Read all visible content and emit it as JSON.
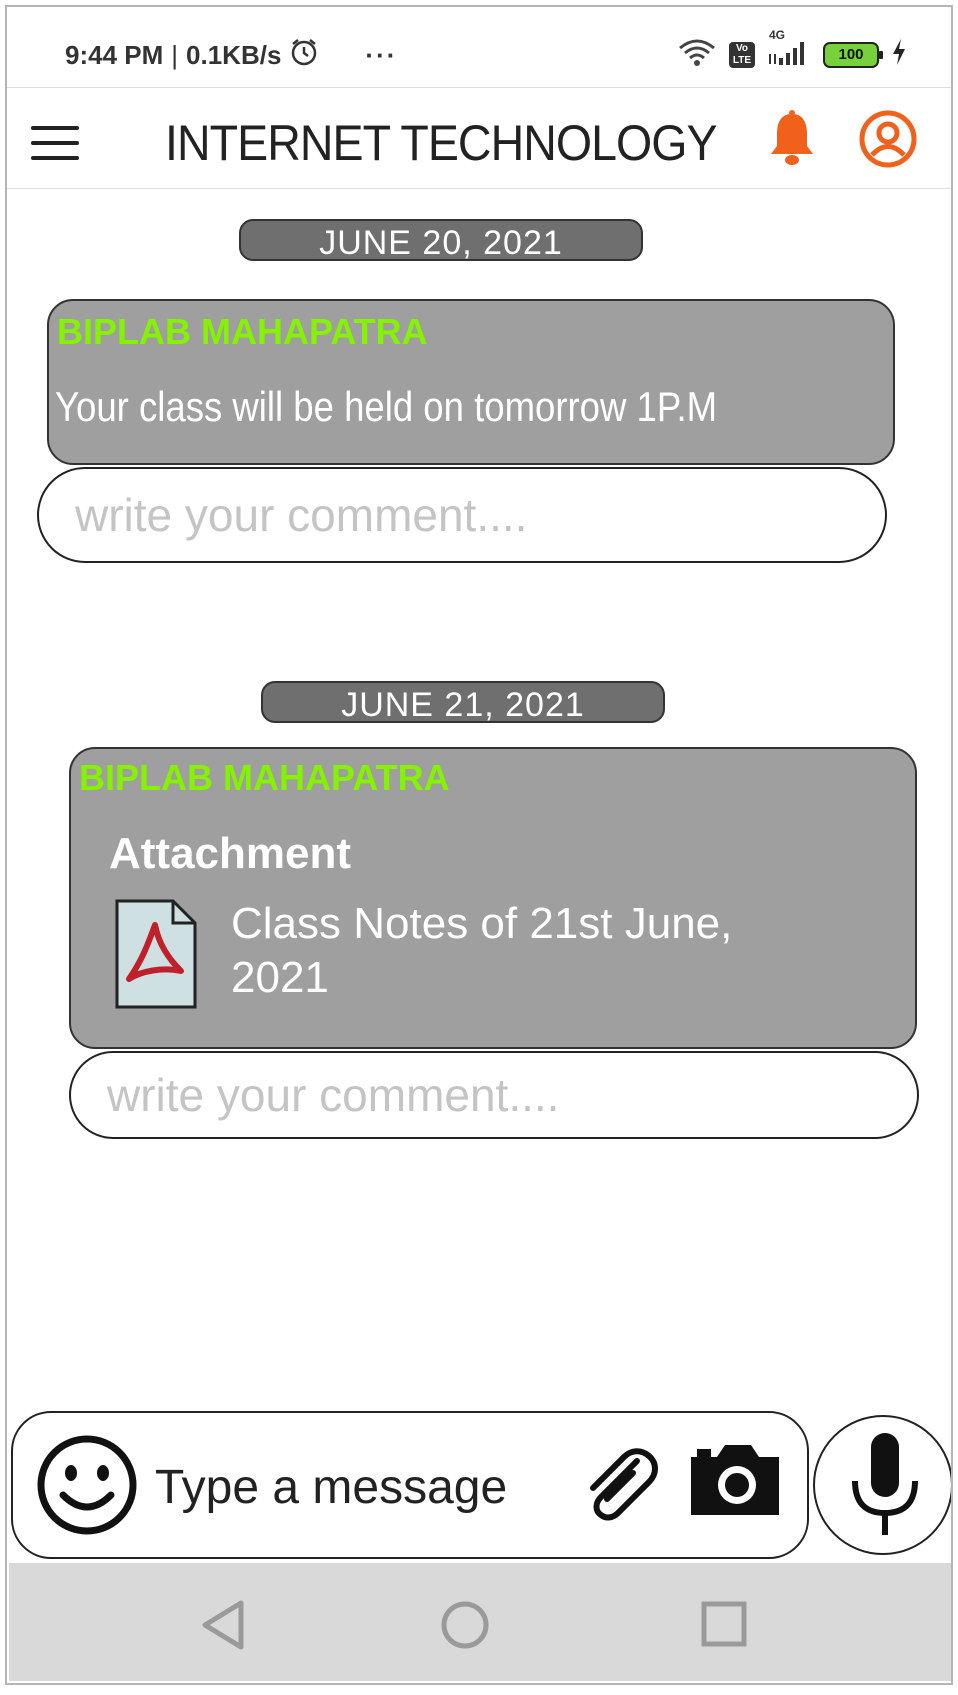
{
  "status_bar": {
    "time": "9:44 PM",
    "separator": "|",
    "network_speed": "0.1KB/s",
    "more": "···",
    "network_type": "4G",
    "volte": "Vo LTE",
    "battery": "100",
    "icons": [
      "alarm-icon",
      "wifi-icon",
      "volte-icon",
      "signal-icon",
      "battery-icon",
      "charging-icon"
    ]
  },
  "header": {
    "title": "INTERNET TECHNOLOGY",
    "icons": [
      "menu-icon",
      "bell-icon",
      "profile-icon"
    ],
    "accent_color": "#f2611b"
  },
  "posts": [
    {
      "date": "JUNE 20, 2021",
      "sender": "BIPLAB MAHAPATRA",
      "text": "Your class will be held on tomorrow 1P.M",
      "comment_placeholder": "write your comment...."
    },
    {
      "date": "JUNE 21, 2021",
      "sender": "BIPLAB MAHAPATRA",
      "attachment_label": "Attachment",
      "attachment_name": "Class Notes of 21st June, 2021",
      "attachment_icon": "pdf-icon",
      "comment_placeholder": "write your comment...."
    }
  ],
  "composer": {
    "placeholder": "Type a message",
    "icons": [
      "emoji-icon",
      "attachment-clip-icon",
      "camera-icon",
      "mic-icon"
    ]
  },
  "nav_bar": {
    "icons": [
      "back-icon",
      "home-icon",
      "recents-icon"
    ]
  },
  "colors": {
    "bubble": "#9e9f9e",
    "sender": "#84f200",
    "date_pill": "#6f6f6f"
  }
}
